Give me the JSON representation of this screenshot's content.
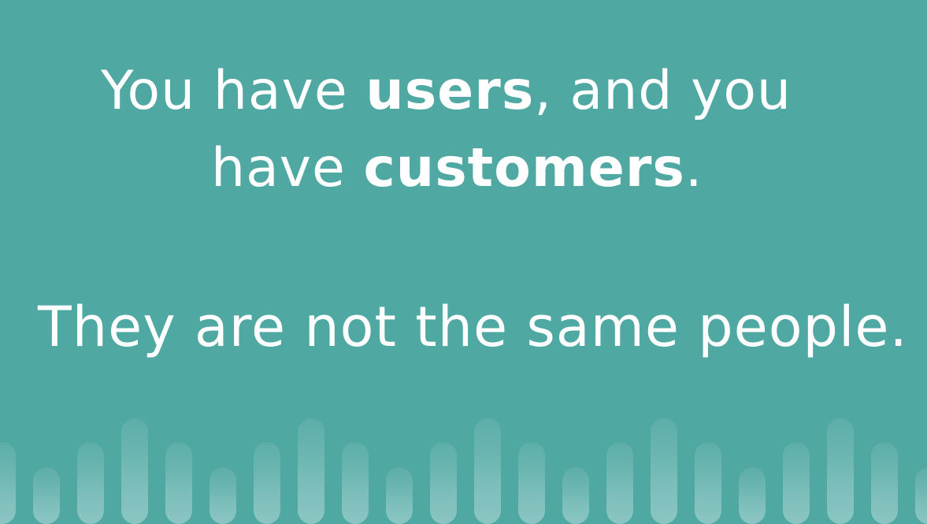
{
  "slide": {
    "line1": {
      "pre": "You have ",
      "bold": "users",
      "post": ", and you"
    },
    "line2": {
      "pre": "have ",
      "bold": "customers",
      "post": "."
    },
    "line3": "They are not the same people."
  },
  "colors": {
    "background": "#50a8a3",
    "text": "#ffffff"
  }
}
